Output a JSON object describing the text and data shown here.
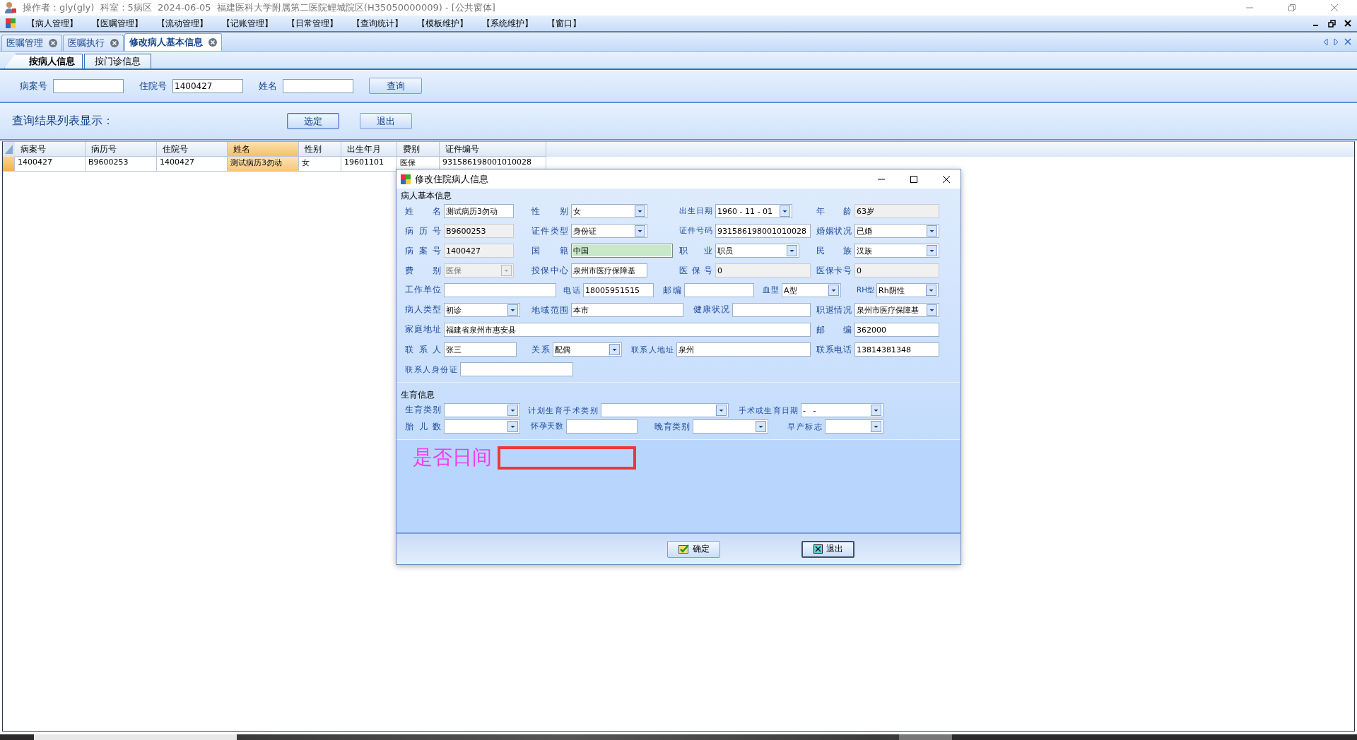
{
  "window": {
    "title": "操作者：gly(gly)  科室：5病区  2024-06-05  福建医科大学附属第二医院鲤城院区(H35050000009) - [公共窗体]"
  },
  "menu": [
    "【病人管理】",
    "【医嘱管理】",
    "【流动管理】",
    "【记账管理】",
    "【日常管理】",
    "【查询统计】",
    "【模板维护】",
    "【系统维护】",
    "【窗口】"
  ],
  "doc_tabs": [
    {
      "label": "医嘱管理",
      "selected": false
    },
    {
      "label": "医嘱执行",
      "selected": false
    },
    {
      "label": "修改病人基本信息",
      "selected": true
    }
  ],
  "sub_tabs": [
    {
      "label": "按病人信息",
      "selected": true
    },
    {
      "label": "按门诊信息",
      "selected": false
    }
  ],
  "query": {
    "fields": [
      {
        "label": "病案号"
      },
      {
        "label": "住院号",
        "value": "1400427"
      },
      {
        "label": "姓名"
      }
    ],
    "button": "查询"
  },
  "results": {
    "caption": "查询结果列表显示：",
    "buttons": [
      "选定",
      "退出"
    ]
  },
  "table": {
    "columns": [
      {
        "label": "病案号",
        "selected": false
      },
      {
        "label": "病历号",
        "selected": false
      },
      {
        "label": "住院号",
        "selected": false
      },
      {
        "label": "姓名",
        "selected": true
      },
      {
        "label": "性别",
        "selected": false
      },
      {
        "label": "出生年月",
        "selected": false
      },
      {
        "label": "费别",
        "selected": false
      },
      {
        "label": "证件编号",
        "selected": false
      }
    ],
    "rows": [
      {
        "selected": true,
        "cells": [
          "1400427",
          "B9600253",
          "1400427",
          "测试病历3勿动",
          "女",
          "19601101",
          "医保",
          "931586198001010028"
        ]
      }
    ]
  },
  "dialog": {
    "title": "修改住院病人信息",
    "groups": [
      {
        "title": "病人基本信息",
        "fields": [
          {
            "label": "姓名",
            "value": "测试病历3勿动",
            "kind": "text"
          },
          {
            "label": "性别",
            "value": "女",
            "kind": "combo"
          },
          {
            "label": "出生日期",
            "value": "1960 - 11 - 01",
            "kind": "date"
          },
          {
            "label": "年龄",
            "value": "63岁",
            "kind": "readonly"
          },
          {
            "label": "病历号",
            "value": "B9600253",
            "kind": "readonly"
          },
          {
            "label": "证件类型",
            "value": "身份证",
            "kind": "combo"
          },
          {
            "label": "证件号码",
            "value": "931586198001010028",
            "kind": "text"
          },
          {
            "label": "婚姻状况",
            "value": "已婚",
            "kind": "combo"
          },
          {
            "label": "病案号",
            "value": "1400427",
            "kind": "readonly"
          },
          {
            "label": "国籍",
            "value": "中国",
            "kind": "focused"
          },
          {
            "label": "职业",
            "value": "职员",
            "kind": "combo"
          },
          {
            "label": "民族",
            "value": "汉族",
            "kind": "combo"
          },
          {
            "label": "费别",
            "value": "医保",
            "kind": "combo-disabled"
          },
          {
            "label": "投保中心",
            "value": "泉州市医疗保障基",
            "kind": "text"
          },
          {
            "label": "医保号",
            "value": "0",
            "kind": "readonly"
          },
          {
            "label": "医保卡号",
            "value": "0",
            "kind": "readonly"
          },
          {
            "label": "工作单位",
            "kind": "text"
          },
          {
            "label": "电话",
            "value": "18005951515",
            "kind": "text"
          },
          {
            "label": "邮编",
            "kind": "text"
          },
          {
            "label": "血型",
            "value": "A型",
            "kind": "combo"
          },
          {
            "label": "RH型",
            "value": "Rh阴性",
            "kind": "combo"
          },
          {
            "label": "病人类型",
            "value": "初诊",
            "kind": "combo"
          },
          {
            "label": "地域范围",
            "value": "本市",
            "kind": "text"
          },
          {
            "label": "健康状况",
            "kind": "text"
          },
          {
            "label": "职退情况",
            "value": "泉州市医疗保障基",
            "kind": "combo"
          },
          {
            "label": "家庭地址",
            "value": "福建省泉州市惠安县",
            "kind": "text"
          },
          {
            "label": "邮编",
            "value": "362000",
            "kind": "text"
          },
          {
            "label": "联系人",
            "value": "张三",
            "kind": "text"
          },
          {
            "label": "关系",
            "value": "配偶",
            "kind": "combo"
          },
          {
            "label": "联系人地址",
            "value": "泉州",
            "kind": "text"
          },
          {
            "label": "联系电话",
            "value": "13814381348",
            "kind": "text"
          },
          {
            "label": "联系人身份证",
            "kind": "text"
          }
        ]
      },
      {
        "title": "生育信息",
        "fields": [
          {
            "label": "生育类别",
            "kind": "combo"
          },
          {
            "label": "计划生育手术类别",
            "kind": "combo"
          },
          {
            "label": "手术或生育日期",
            "kind": "date",
            "value": "-   -"
          }
        ]
      },
      {
        "fields": [
          {
            "label": "胎儿数",
            "kind": "combo"
          },
          {
            "label": "怀孕天数",
            "kind": "text"
          },
          {
            "label": "晚育类别",
            "kind": "combo"
          },
          {
            "label": "早产标志",
            "kind": "combo"
          }
        ]
      }
    ],
    "day_case": {
      "label": "是否日间"
    },
    "buttons": [
      {
        "label": "确定",
        "kind": "ok",
        "focused": false
      },
      {
        "label": "退出",
        "kind": "cancel",
        "focused": true
      }
    ]
  }
}
